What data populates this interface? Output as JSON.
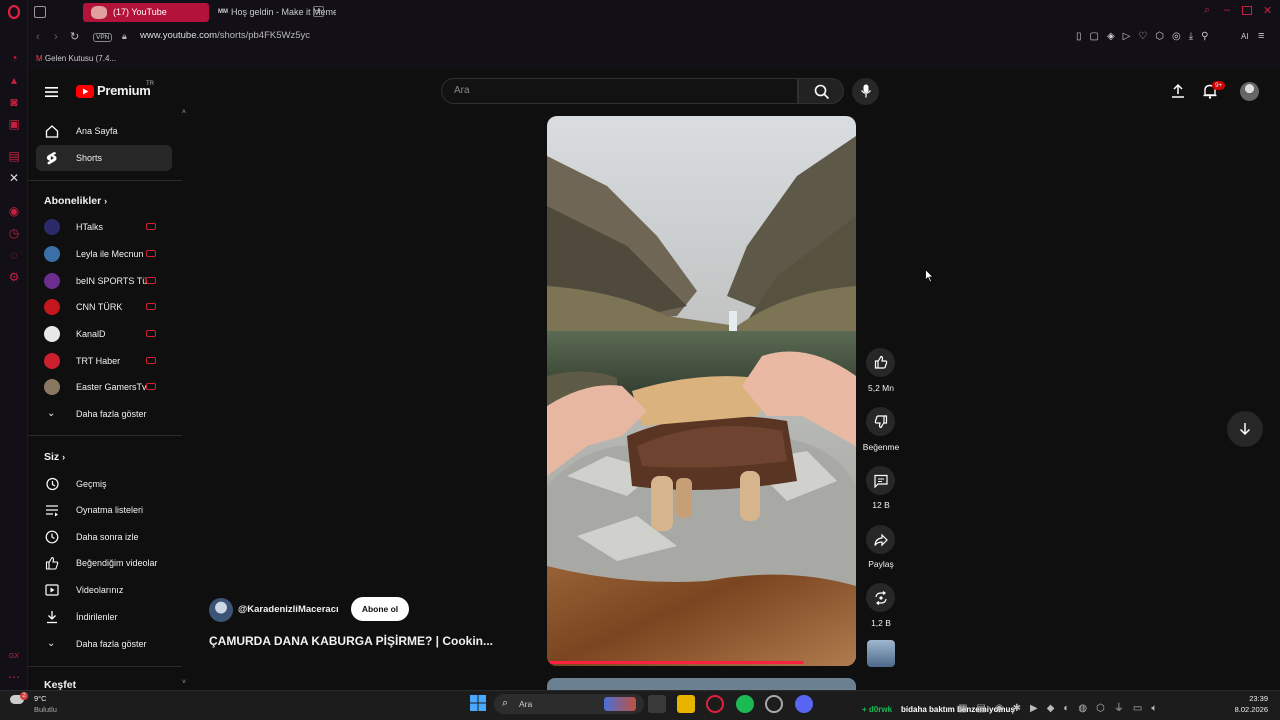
{
  "browser": {
    "tabs": [
      {
        "label": "(17) YouTube"
      },
      {
        "label": "Hoş geldin - Make it Meme"
      }
    ],
    "vpn_badge": "VPN",
    "url_host": "www.youtube.com",
    "url_path": "/shorts/pb4FK5Wz5yc",
    "bookmark": "Gelen Kutusu (7.4...",
    "ai_label": "AI"
  },
  "youtube": {
    "logo_text": "Premium",
    "logo_region": "TR",
    "search_placeholder": "Ara",
    "notifications_badge": "9+",
    "sidebar": {
      "main": [
        {
          "label": "Ana Sayfa",
          "icon": "home-icon"
        },
        {
          "label": "Shorts",
          "icon": "shorts-icon"
        }
      ],
      "subs_title": "Abonelikler",
      "subscriptions": [
        {
          "label": "HTalks",
          "color": "#2a2a6a"
        },
        {
          "label": "Leyla ile Mecnun",
          "color": "#3a6fa8"
        },
        {
          "label": "beIN SPORTS Tü...",
          "color": "#6b2d8f"
        },
        {
          "label": "CNN TÜRK",
          "color": "#c4161c"
        },
        {
          "label": "KanalD",
          "color": "#e8e8e8"
        },
        {
          "label": "TRT Haber",
          "color": "#cc1f2d"
        },
        {
          "label": "Easter GamersTv",
          "color": "#8a7760"
        }
      ],
      "subs_more": "Daha fazla göster",
      "you_title": "Siz",
      "you_items": [
        {
          "label": "Geçmiş",
          "icon": "history-icon"
        },
        {
          "label": "Oynatma listeleri",
          "icon": "playlist-icon"
        },
        {
          "label": "Daha sonra izle",
          "icon": "clock-icon"
        },
        {
          "label": "Beğendiğim videolar",
          "icon": "thumbs-up-icon"
        },
        {
          "label": "Videolarınız",
          "icon": "video-icon"
        },
        {
          "label": "İndirilenler",
          "icon": "download-icon"
        }
      ],
      "you_more": "Daha fazla göster",
      "explore_title": "Keşfet"
    },
    "short": {
      "channel": "@KaradenizliMaceracı",
      "subscribe_label": "Abone ol",
      "title": "ÇAMURDA DANA KABURGA PİŞİRME? | Cookin...",
      "progress": 0.83,
      "actions": {
        "likes": "5,2 Mn",
        "dislike": "Beğenme",
        "comments": "12 B",
        "share": "Paylaş",
        "remix": "1,2 B"
      }
    }
  },
  "taskbar": {
    "weather_temp": "9°C",
    "weather_desc": "Bulutlu",
    "weather_badge": "2",
    "search_label": "Ara",
    "now_playing_prefix": "d0rwk",
    "now_playing": "bidaha baktım benzemiyomuş",
    "time": "23:39",
    "date": "8.02.2026"
  },
  "colors": {
    "opera_red": "#c62040",
    "yt_red": "#ff0000",
    "background": "#0f0f0f",
    "spotify_green": "#1db954"
  }
}
